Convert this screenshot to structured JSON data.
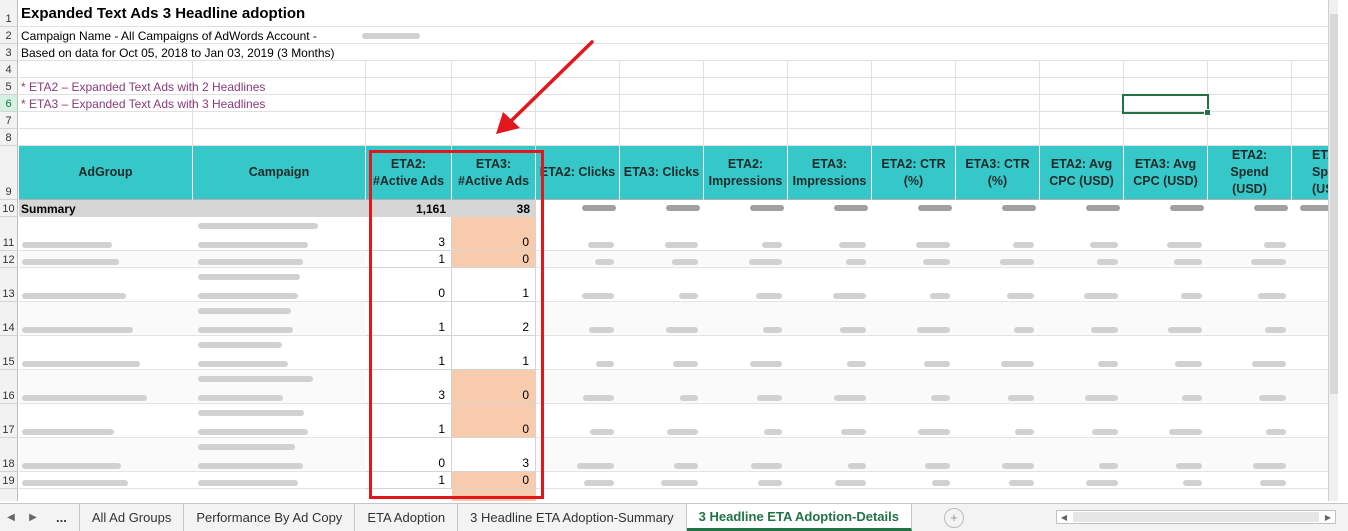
{
  "report": {
    "title": "Expanded Text Ads 3 Headline adoption",
    "campaign_line": "Campaign Name - All Campaigns of AdWords Account -",
    "date_line": "Based on data for Oct 05, 2018 to Jan 03, 2019 (3 Months)",
    "note_eta2": "* ETA2 – Expanded Text Ads with 2 Headlines",
    "note_eta3": "* ETA3 – Expanded Text Ads with 3 Headlines"
  },
  "row_numbers": [
    "1",
    "2",
    "3",
    "4",
    "5",
    "6",
    "7",
    "8",
    "9",
    "10",
    "11",
    "12",
    "13",
    "14",
    "15",
    "16",
    "17",
    "18",
    "19"
  ],
  "headers": {
    "adgroup": "AdGroup",
    "campaign": "Campaign",
    "eta2_active_1": "ETA2:",
    "eta2_active_2": "#Active Ads",
    "eta3_active_1": "ETA3:",
    "eta3_active_2": "#Active Ads",
    "eta2_clicks": "ETA2: Clicks",
    "eta3_clicks": "ETA3: Clicks",
    "eta2_impr_1": "ETA2:",
    "eta2_impr_2": "Impressions",
    "eta3_impr_1": "ETA3:",
    "eta3_impr_2": "Impressions",
    "eta2_ctr_1": "ETA2: CTR",
    "eta2_ctr_2": "(%)",
    "eta3_ctr_1": "ETA3: CTR",
    "eta3_ctr_2": "(%)",
    "eta2_cpc_1": "ETA2: Avg",
    "eta2_cpc_2": "CPC (USD)",
    "eta3_cpc_1": "ETA3: Avg",
    "eta3_cpc_2": "CPC (USD)",
    "eta2_spend_1": "ETA2:",
    "eta2_spend_2": "Spend",
    "eta2_spend_3": "(USD)",
    "eta3_spend_1": "ETA",
    "eta3_spend_2": "Spe",
    "eta3_spend_3": "(US"
  },
  "summary": {
    "label": "Summary",
    "eta2_active": "1,161",
    "eta3_active": "38"
  },
  "rows": [
    {
      "row": "11",
      "eta2": "3",
      "eta3": "0"
    },
    {
      "row": "12",
      "eta2": "1",
      "eta3": "0"
    },
    {
      "row": "13",
      "eta2": "0",
      "eta3": "1"
    },
    {
      "row": "14",
      "eta2": "1",
      "eta3": "2"
    },
    {
      "row": "15",
      "eta2": "1",
      "eta3": "1"
    },
    {
      "row": "16",
      "eta2": "3",
      "eta3": "0"
    },
    {
      "row": "17",
      "eta2": "1",
      "eta3": "0"
    },
    {
      "row": "18",
      "eta2": "0",
      "eta3": "3"
    },
    {
      "row": "19",
      "eta2": "1",
      "eta3": "0"
    }
  ],
  "tabs": {
    "ellipsis": "...",
    "t1": "All Ad Groups",
    "t2": "Performance By Ad Copy",
    "t3": "ETA Adoption",
    "t4": "3 Headline ETA Adoption-Summary",
    "t5": "3 Headline ETA Adoption-Details",
    "add": "+"
  },
  "colors": {
    "header_teal": "#36c8c8",
    "peach_zero": "#f8cbad",
    "annotation_red": "#e4161d",
    "excel_green": "#217346",
    "note_purple": "#8b3a7a"
  }
}
